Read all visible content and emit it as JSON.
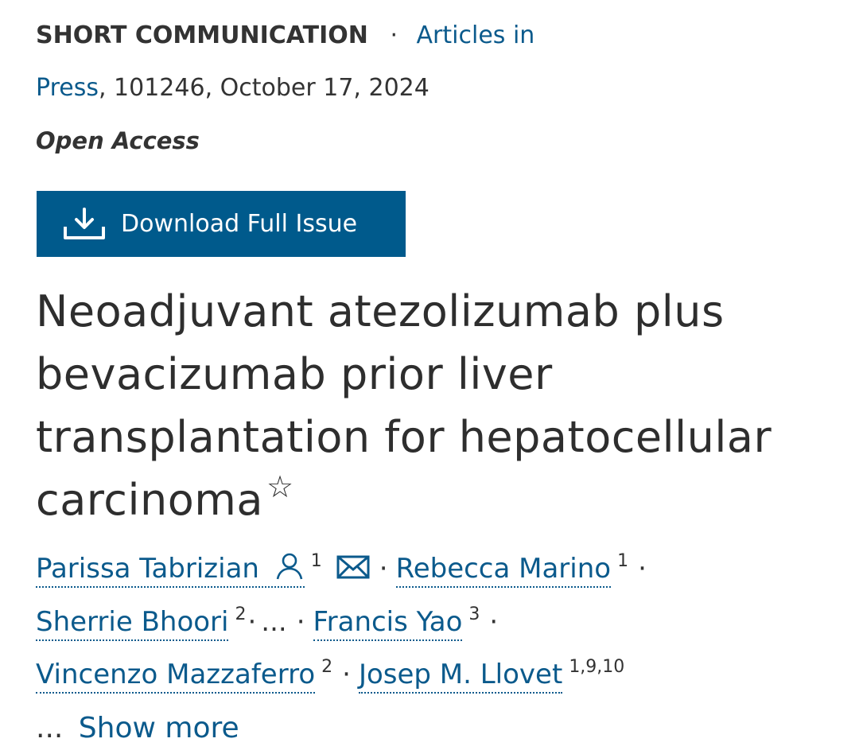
{
  "header": {
    "article_type": "SHORT COMMUNICATION",
    "separator": "·",
    "issue_link_part1": "Articles in",
    "issue_link_part2": "Press",
    "citation": ", 101246, October 17, 2024",
    "access": "Open Access"
  },
  "download_button": {
    "label": "Download Full Issue",
    "icon": "download-icon"
  },
  "title": {
    "text": "Neoadjuvant atezolizumab plus bevacizumab prior liver transplantation for hepatocellular carcinoma",
    "marker": "☆"
  },
  "authors": [
    {
      "name": "Parissa Tabrizian",
      "sup": "1",
      "icons": [
        "person-icon",
        "mail-icon"
      ]
    },
    {
      "name": "Rebecca Marino",
      "sup": "1"
    },
    {
      "name": "Sherrie Bhoori",
      "sup": "2"
    },
    {
      "name": "Francis Yao",
      "sup": "3"
    },
    {
      "name": "Vincenzo Mazzaferro",
      "sup": "2"
    },
    {
      "name": "Josep M. Llovet",
      "sup": "1,9,10"
    }
  ],
  "authors_ellipsis": "...",
  "author_separator": "·",
  "show_more": "Show more",
  "colors": {
    "link": "#0b5a8c",
    "button_bg": "#005a8c",
    "text": "#333333"
  }
}
